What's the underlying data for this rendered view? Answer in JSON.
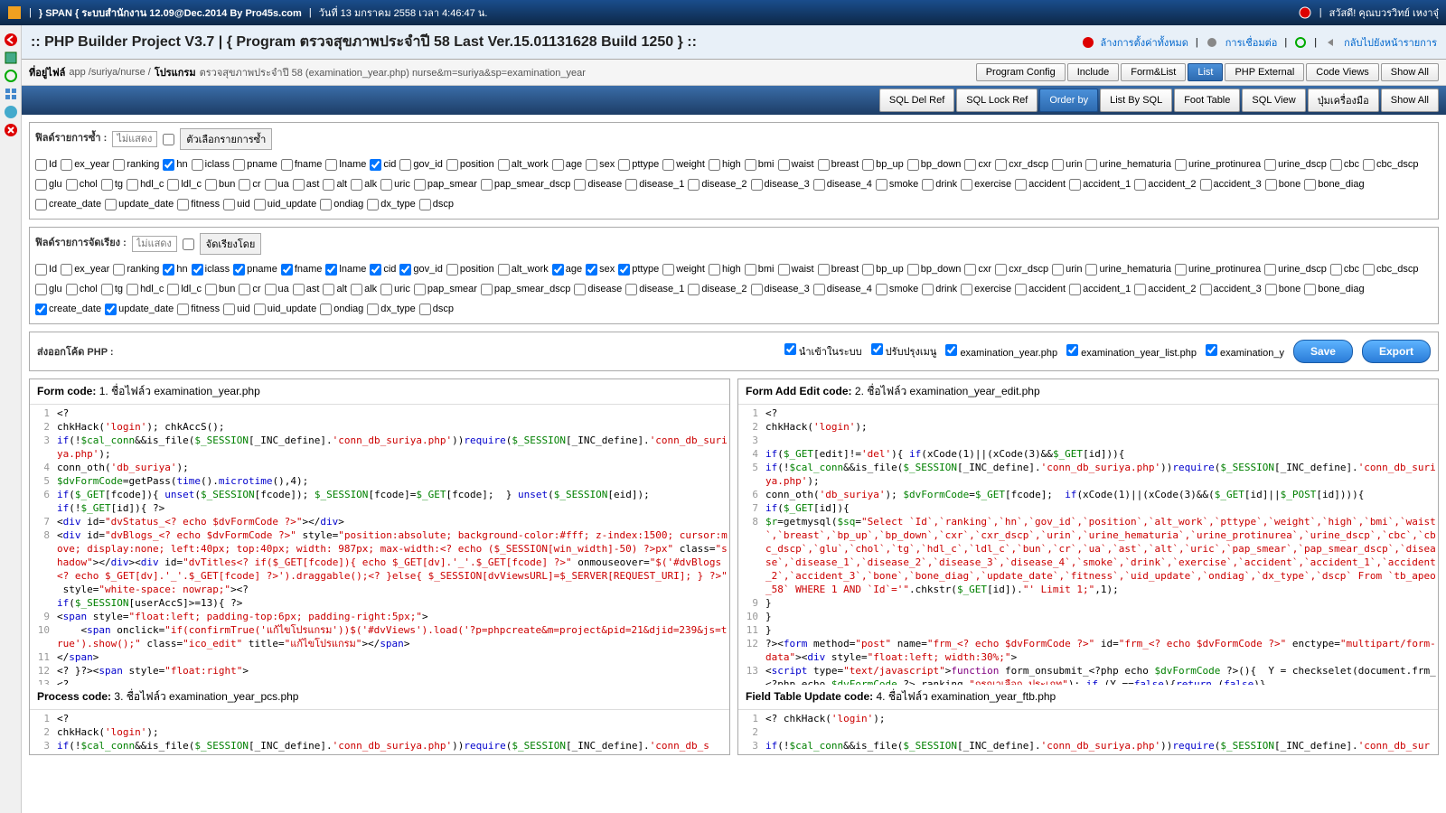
{
  "topbar": {
    "title": "} SPAN { ระบบสำนักงาน 12.09@Dec.2014 By Pro45s.com",
    "date": "วันที่ 13 มกราคม 2558 เวลา 4:46:47 น.",
    "greeting": "สวัสดี! คุณบวรวิทย์ เหงาจุ๋"
  },
  "subbar": {
    "title": ":: PHP Builder Project V3.7 | { Program ตรวจสุขภาพประจำปี 58 Last Ver.15.01131628 Build 1250 } ::",
    "clear": "ล้างการตั้งค่าทั้งหมด",
    "connect": "การเชื่อมต่อ",
    "back": "กลับไปยังหน้ารายการ"
  },
  "pathbar": {
    "label": "ที่อยู่ไฟล์",
    "path": "app /suriya/nurse /",
    "prog_label": "โปรแกรม",
    "prog": "ตรวจสุขภาพประจำปี 58 (examination_year.php) nurse&m=suriya&sp=examination_year"
  },
  "btnrow1": [
    "Program Config",
    "Include",
    "Form&List",
    "List",
    "PHP External",
    "Code Views",
    "Show All"
  ],
  "btnrow1_active": 3,
  "btnrow2": [
    "SQL Del Ref",
    "SQL Lock Ref",
    "Order by",
    "List By SQL",
    "Foot Table",
    "SQL View",
    "ปุ่มเครื่องมือ",
    "Show All"
  ],
  "btnrow2_active": 2,
  "section1": {
    "label": "ฟิลด์รายการซ้ำ :",
    "placeholder": "ไม่แสดง",
    "btn": "ตัวเลือกรายการซ้ำ"
  },
  "section2": {
    "label": "ฟิลด์รายการจัดเรียง :",
    "placeholder": "ไม่แสดง",
    "btn": "จัดเรียงโดย"
  },
  "fields": [
    "Id",
    "ex_year",
    "ranking",
    "hn",
    "iclass",
    "pname",
    "fname",
    "lname",
    "cid",
    "gov_id",
    "position",
    "alt_work",
    "age",
    "sex",
    "pttype",
    "weight",
    "high",
    "bmi",
    "waist",
    "breast",
    "bp_up",
    "bp_down",
    "cxr",
    "cxr_dscp",
    "urin",
    "urine_hematuria",
    "urine_protinurea",
    "urine_dscp",
    "cbc",
    "cbc_dscp",
    "glu",
    "chol",
    "tg",
    "hdl_c",
    "ldl_c",
    "bun",
    "cr",
    "ua",
    "ast",
    "alt",
    "alk",
    "uric",
    "pap_smear",
    "pap_smear_dscp",
    "disease",
    "disease_1",
    "disease_2",
    "disease_3",
    "disease_4",
    "smoke",
    "drink",
    "exercise",
    "accident",
    "accident_1",
    "accident_2",
    "accident_3",
    "bone",
    "bone_diag",
    "create_date",
    "update_date",
    "fitness",
    "uid",
    "uid_update",
    "ondiag",
    "dx_type",
    "dscp"
  ],
  "checked1": {
    "hn": true,
    "cid": true
  },
  "checked2": {
    "hn": true,
    "iclass": true,
    "pname": true,
    "fname": true,
    "lname": true,
    "cid": true,
    "gov_id": true,
    "age": true,
    "sex": true,
    "pttype": true,
    "create_date": true,
    "update_date": true
  },
  "send": {
    "label": "ส่งออกโค้ด PHP :",
    "chk1": "นำเข้าในระบบ",
    "chk2": "ปรับปรุงเมนู",
    "chk3": "examination_year.php",
    "chk4": "examination_year_list.php",
    "chk5": "examination_y",
    "save": "Save",
    "export": "Export"
  },
  "panels": {
    "p1": {
      "title": "Form code:",
      "sub": "1. ชื่อไฟล์ว examination_year.php"
    },
    "p2": {
      "title": "Form Add Edit code:",
      "sub": "2. ชื่อไฟล์ว examination_year_edit.php"
    },
    "p3": {
      "title": "Process code:",
      "sub": "3. ชื่อไฟล์ว examination_year_pcs.php"
    },
    "p4": {
      "title": "Field Table Update code:",
      "sub": "4. ชื่อไฟล์ว examination_year_ftb.php"
    }
  }
}
